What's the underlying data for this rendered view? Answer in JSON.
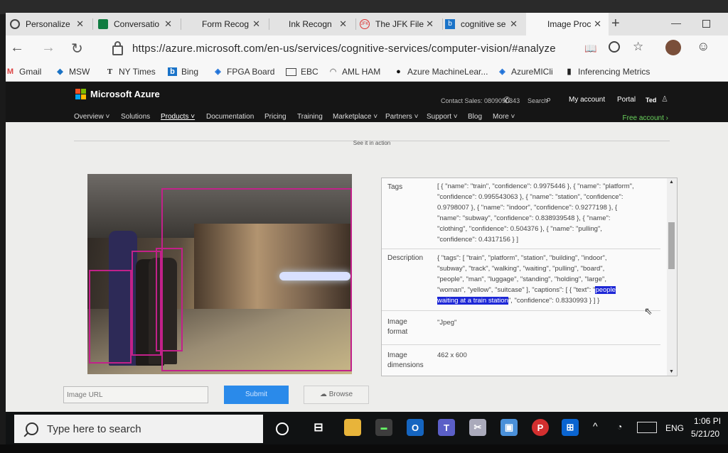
{
  "browser": {
    "tabs": [
      {
        "label": "Personalize"
      },
      {
        "label": "Conversatio"
      },
      {
        "label": "Form Recog"
      },
      {
        "label": "Ink Recogn"
      },
      {
        "label": "The JFK File"
      },
      {
        "label": "cognitive se"
      },
      {
        "label": "Image Proc"
      }
    ],
    "url": "https://azure.microsoft.com/en-us/services/cognitive-services/computer-vision/#analyze",
    "bookmarks": [
      {
        "label": "Gmail"
      },
      {
        "label": "MSW"
      },
      {
        "label": "NY Times"
      },
      {
        "label": "Bing"
      },
      {
        "label": "FPGA Board"
      },
      {
        "label": "EBC"
      },
      {
        "label": "AML HAM"
      },
      {
        "label": "Azure MachineLear..."
      },
      {
        "label": "AzureMICli"
      },
      {
        "label": "Inferencing Metrics"
      }
    ]
  },
  "azure": {
    "brand": "Microsoft Azure",
    "contact": "Contact Sales: 0809090343",
    "search": "Search",
    "my_account": "My account",
    "portal": "Portal",
    "user": "Ted",
    "nav": [
      {
        "label": "Overview ˅"
      },
      {
        "label": "Solutions"
      },
      {
        "label": "Products ˅"
      },
      {
        "label": "Documentation"
      },
      {
        "label": "Pricing"
      },
      {
        "label": "Training"
      },
      {
        "label": "Marketplace ˅"
      },
      {
        "label": "Partners ˅"
      },
      {
        "label": "Support ˅"
      },
      {
        "label": "Blog"
      },
      {
        "label": "More ˅"
      }
    ],
    "free_account": "Free account ›"
  },
  "page": {
    "section_label": "See it in action",
    "results": {
      "tags_label": "Tags",
      "tags_lines": [
        "[ { \"name\": \"train\", \"confidence\": 0.9975446 }, { \"name\": \"platform\",",
        "\"confidence\": 0.995543063 }, { \"name\": \"station\", \"confidence\":",
        "0.9798007 }, { \"name\": \"indoor\", \"confidence\": 0.9277198 }, {",
        "\"name\": \"subway\", \"confidence\": 0.838939548 }, { \"name\":",
        "\"clothing\", \"confidence\": 0.504376 }, { \"name\": \"pulling\",",
        "\"confidence\": 0.4317156 } ]"
      ],
      "description_label": "Description",
      "description_lines": [
        "{ \"tags\": [ \"train\", \"platform\", \"station\", \"building\", \"indoor\",",
        "\"subway\", \"track\", \"walking\", \"waiting\", \"pulling\", \"board\",",
        "\"people\", \"man\", \"luggage\", \"standing\", \"holding\", \"large\",",
        "\"woman\", \"yellow\", \"suitcase\" ], \"captions\": [ { \"text\": \""
      ],
      "caption_part1": "people",
      "caption_part2": "waiting at a train station",
      "description_tail": "\", \"confidence\": 0.8330993 } ] }",
      "format_label": "Image format",
      "format_value": "\"Jpeg\"",
      "dimensions_label": "Image dimensions",
      "dimensions_value": "462 x 600"
    },
    "image_url_placeholder": "Image URL",
    "submit_label": "Submit",
    "browse_label": "Browse"
  },
  "taskbar": {
    "search_placeholder": "Type here to search",
    "language": "ENG",
    "time": "1:06 PI",
    "date": "5/21/20"
  },
  "colors": {
    "azure_green": "#6ad35d",
    "submit_blue": "#2a8aea",
    "bbox_magenta": "#c2218a",
    "highlight": "#1d27d6"
  }
}
